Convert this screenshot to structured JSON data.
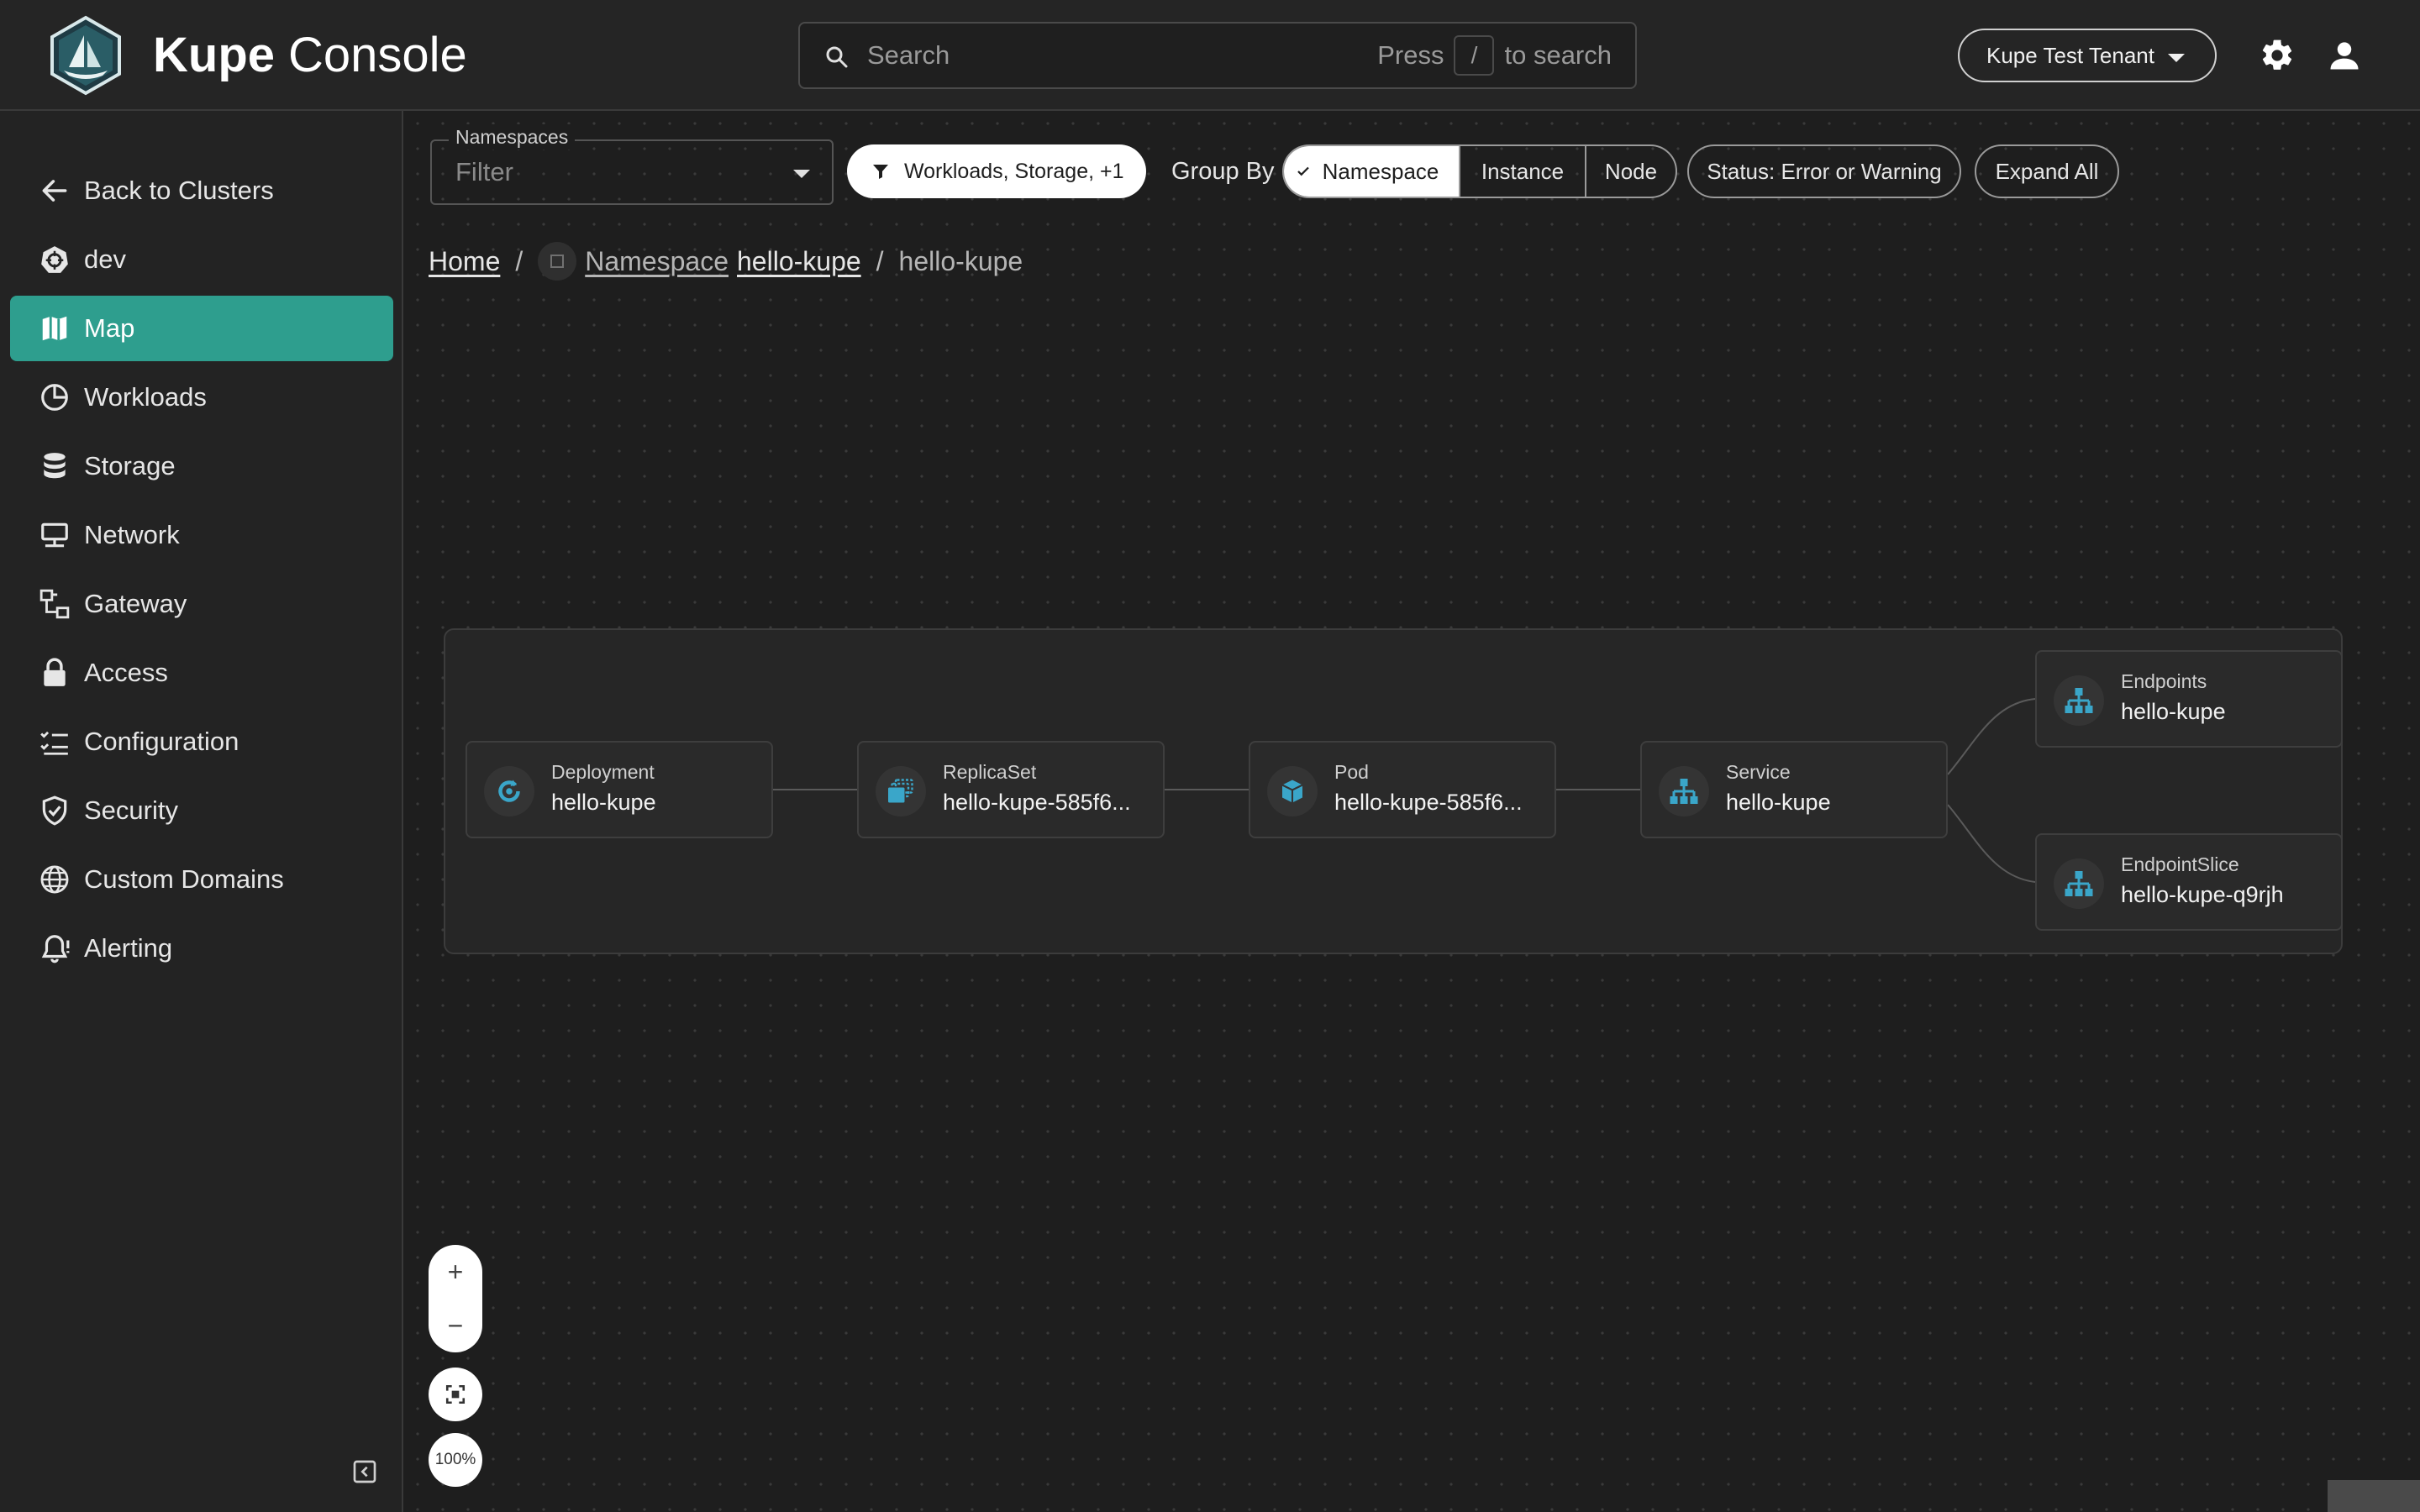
{
  "app": {
    "brand_bold": "Kupe",
    "brand_light": "Console"
  },
  "search": {
    "placeholder": "Search",
    "hint_press": "Press",
    "hint_key": "/",
    "hint_suffix": "to search"
  },
  "header": {
    "tenant": "Kupe Test Tenant"
  },
  "sidebar": {
    "items": [
      {
        "label": "Back to Clusters",
        "icon": "arrow-left-icon"
      },
      {
        "label": "dev",
        "icon": "kubernetes-icon"
      },
      {
        "label": "Map",
        "icon": "map-icon",
        "active": true
      },
      {
        "label": "Workloads",
        "icon": "pie-chart-icon"
      },
      {
        "label": "Storage",
        "icon": "database-icon"
      },
      {
        "label": "Network",
        "icon": "network-icon"
      },
      {
        "label": "Gateway",
        "icon": "gateway-icon"
      },
      {
        "label": "Access",
        "icon": "lock-icon"
      },
      {
        "label": "Configuration",
        "icon": "configuration-icon"
      },
      {
        "label": "Security",
        "icon": "shield-icon"
      },
      {
        "label": "Custom Domains",
        "icon": "globe-icon"
      },
      {
        "label": "Alerting",
        "icon": "bell-icon"
      }
    ]
  },
  "toolbar": {
    "namespaces_label": "Namespaces",
    "namespaces_placeholder": "Filter",
    "filter_label": "Workloads, Storage, +1",
    "group_by_label": "Group By",
    "group_by_options": [
      "Namespace",
      "Instance",
      "Node"
    ],
    "group_by_selected": "Namespace",
    "status_label": "Status: Error or Warning",
    "expand_label": "Expand All"
  },
  "breadcrumb": {
    "home": "Home",
    "sep": "/",
    "ns_prefix": "Namespace",
    "ns_name": "hello-kupe",
    "current": "hello-kupe"
  },
  "graph": {
    "nodes": [
      {
        "kind": "Deployment",
        "name": "hello-kupe",
        "icon": "deployment-icon"
      },
      {
        "kind": "ReplicaSet",
        "name": "hello-kupe-585f6...",
        "icon": "replicaset-icon"
      },
      {
        "kind": "Pod",
        "name": "hello-kupe-585f6...",
        "icon": "pod-icon"
      },
      {
        "kind": "Service",
        "name": "hello-kupe",
        "icon": "service-icon"
      },
      {
        "kind": "Endpoints",
        "name": "hello-kupe",
        "icon": "endpoints-icon"
      },
      {
        "kind": "EndpointSlice",
        "name": "hello-kupe-q9rjh",
        "icon": "endpointslice-icon"
      }
    ]
  },
  "zoom": {
    "plus": "+",
    "minus": "−",
    "level": "100%"
  },
  "colors": {
    "accent": "#2e9e8e",
    "node_icon": "#3aa6c9"
  }
}
